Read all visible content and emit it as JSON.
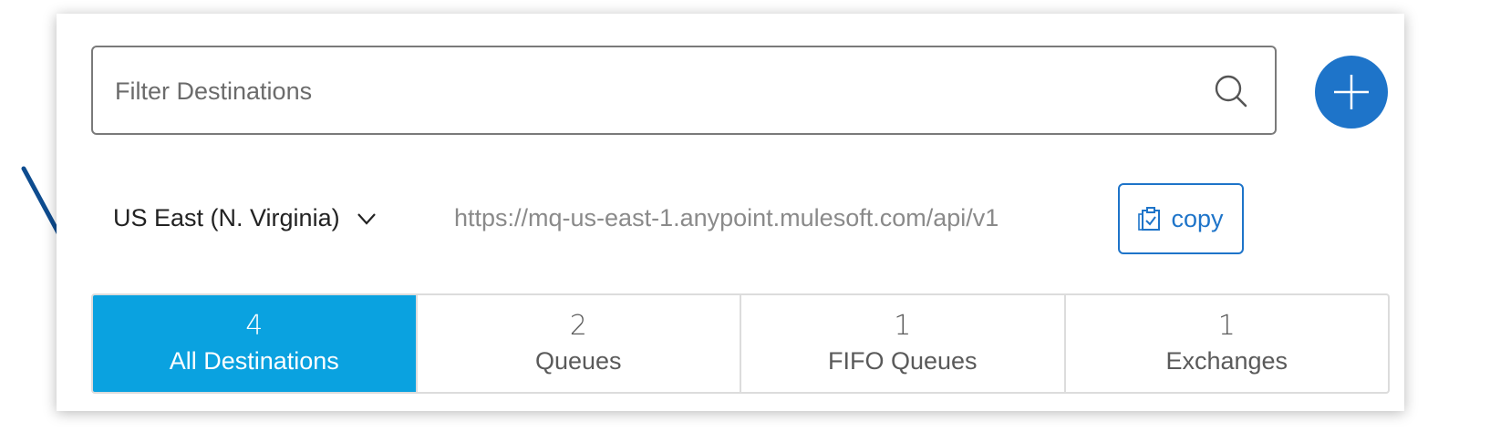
{
  "search": {
    "placeholder": "Filter Destinations",
    "value": ""
  },
  "add_button": {
    "icon": "plus-icon"
  },
  "region": {
    "selected": "US East (N. Virginia)",
    "icon": "chevron-down-icon"
  },
  "endpoint_url": "https://mq-us-east-1.anypoint.mulesoft.com/api/v1",
  "copy_button": {
    "label": "copy",
    "icon": "clipboard-check-icon"
  },
  "tabs": [
    {
      "count": "4",
      "label": "All Destinations",
      "active": true
    },
    {
      "count": "2",
      "label": "Queues",
      "active": false
    },
    {
      "count": "1",
      "label": "FIFO Queues",
      "active": false
    },
    {
      "count": "1",
      "label": "Exchanges",
      "active": false
    }
  ],
  "colors": {
    "accent_blue": "#1e74c9",
    "active_tab": "#0aa2e0",
    "annotation_arrow": "#0e4c8f"
  }
}
